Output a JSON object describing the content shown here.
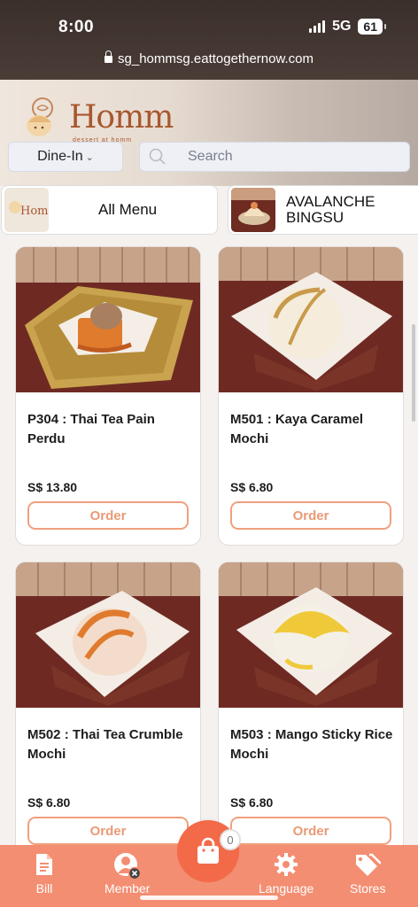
{
  "status_bar": {
    "time": "8:00",
    "network": "5G",
    "battery": "61"
  },
  "browser": {
    "url": "sg_hommsg.eattogethernow.com"
  },
  "brand": {
    "logo_text": "Homm",
    "logo_sub": "dessert at homm"
  },
  "controls": {
    "dine_mode": "Dine-In",
    "search_placeholder": "Search"
  },
  "categories": [
    {
      "label": "All Menu"
    },
    {
      "label": "AVALANCHE BINGSU"
    }
  ],
  "products": [
    {
      "name": "P304 : Thai Tea Pain Perdu",
      "price": "S$ 13.80",
      "button": "Order"
    },
    {
      "name": "M501 : Kaya Caramel Mochi",
      "price": "S$ 6.80",
      "button": "Order"
    },
    {
      "name": "M502 : Thai Tea Crumble Mochi",
      "price": "S$ 6.80",
      "button": "Order"
    },
    {
      "name": "M503 : Mango Sticky Rice Mochi",
      "price": "S$ 6.80",
      "button": "Order"
    }
  ],
  "cart": {
    "count": "0"
  },
  "bottom_nav": [
    {
      "label": "Bill",
      "icon": "bill-icon"
    },
    {
      "label": "Member",
      "icon": "member-icon"
    },
    {
      "label": "Language",
      "icon": "gear-icon"
    },
    {
      "label": "Stores",
      "icon": "tags-icon"
    }
  ],
  "colors": {
    "accent": "#f38e72",
    "cart": "#f36a49",
    "order_border": "#f0a07e"
  }
}
